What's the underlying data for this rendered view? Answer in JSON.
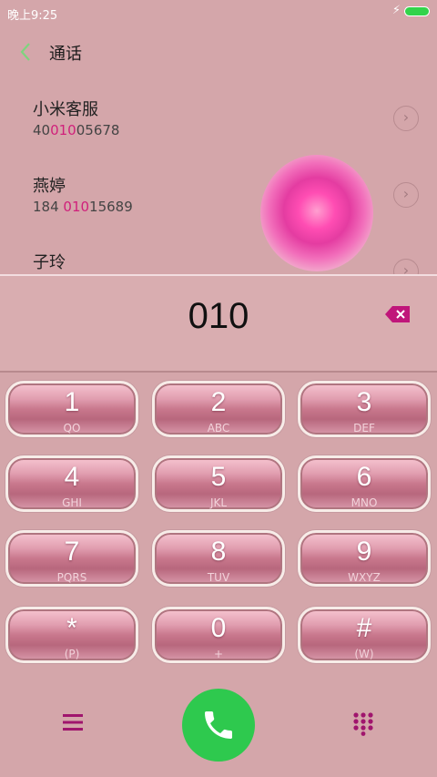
{
  "status": {
    "time": "晚上9:25"
  },
  "header": {
    "title": "通话"
  },
  "contacts": [
    {
      "name": "小米客服",
      "number_pre": "40",
      "number_hl": "010",
      "number_post": "05678"
    },
    {
      "name": "燕婷",
      "number_pre": "184 ",
      "number_hl": "010",
      "number_post": "15689"
    },
    {
      "name": "子玲",
      "number_pre": "",
      "number_hl": "",
      "number_post": ""
    }
  ],
  "dialer": {
    "number": "010"
  },
  "keypad": [
    {
      "digit": "1",
      "letters": "QO"
    },
    {
      "digit": "2",
      "letters": "ABC"
    },
    {
      "digit": "3",
      "letters": "DEF"
    },
    {
      "digit": "4",
      "letters": "GHI"
    },
    {
      "digit": "5",
      "letters": "JKL"
    },
    {
      "digit": "6",
      "letters": "MNO"
    },
    {
      "digit": "7",
      "letters": "PQRS"
    },
    {
      "digit": "8",
      "letters": "TUV"
    },
    {
      "digit": "9",
      "letters": "WXYZ"
    },
    {
      "digit": "*",
      "letters": "(P)"
    },
    {
      "digit": "0",
      "letters": "+"
    },
    {
      "digit": "#",
      "letters": "(W)"
    }
  ],
  "colors": {
    "accent": "#d0207b",
    "call": "#2ec94e",
    "background": "#d4a6aa"
  }
}
